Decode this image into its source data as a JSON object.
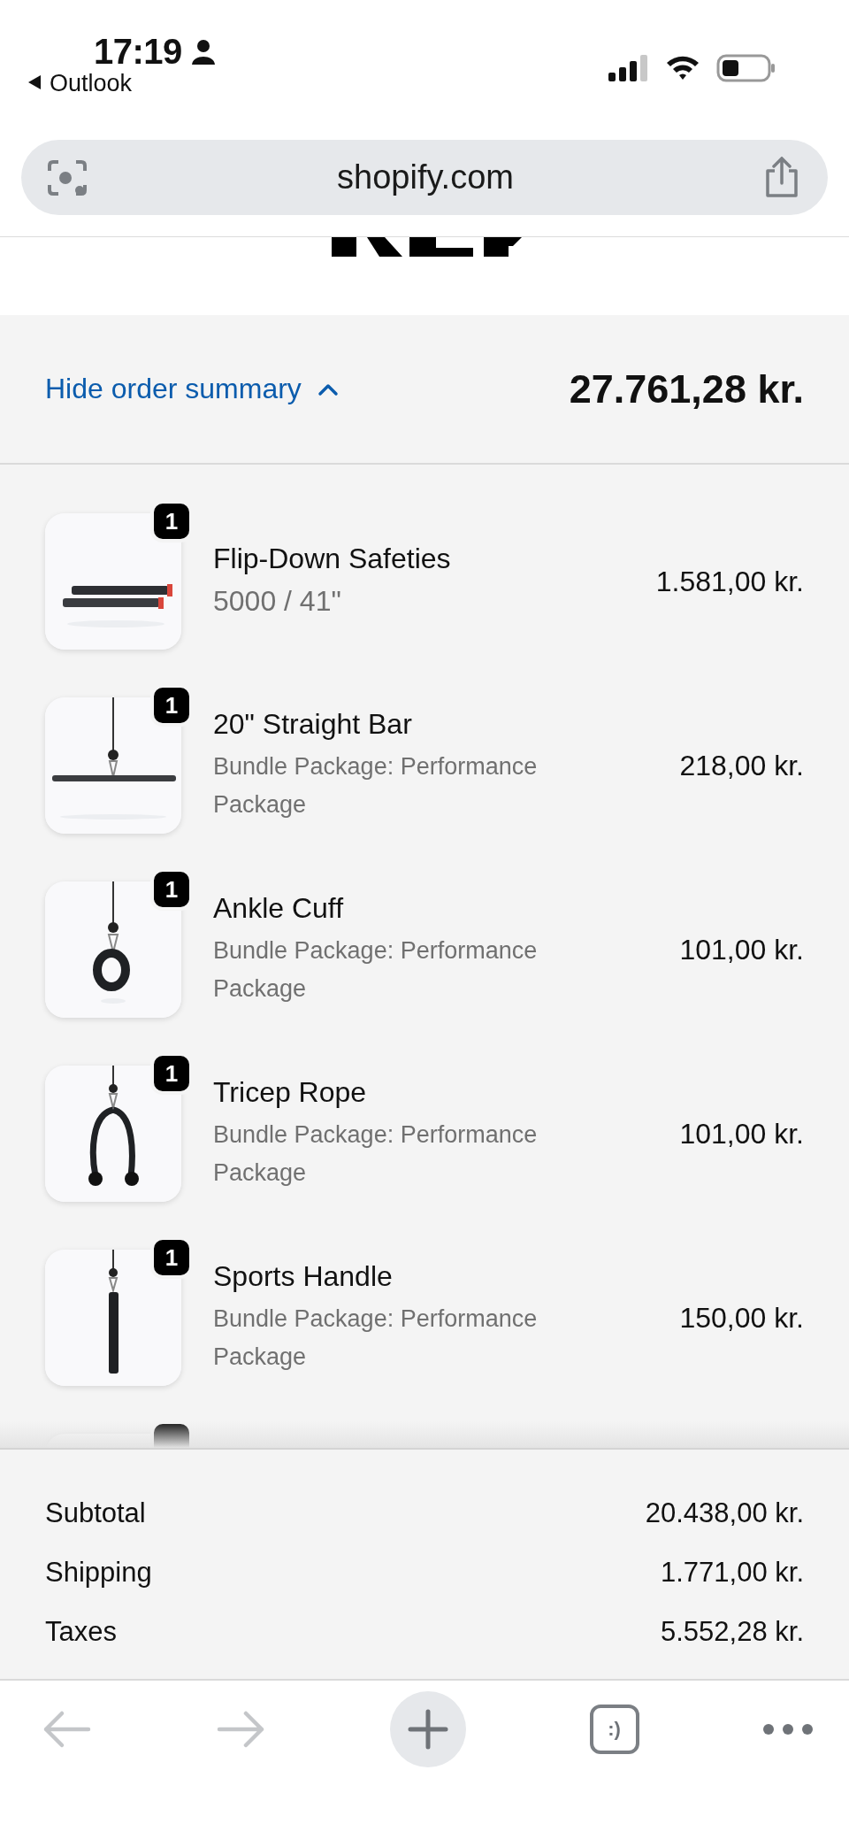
{
  "status_bar": {
    "time": "17:19",
    "back_app": "Outlook"
  },
  "address_bar": {
    "url": "shopify.com"
  },
  "order_summary": {
    "toggle_label": "Hide order summary",
    "expanded": true,
    "total": "27.761,28 kr."
  },
  "line_items": [
    {
      "name": "Flip-Down Safeties",
      "variant": "5000 / 41\"",
      "price": "1.581,00 kr.",
      "quantity": "1",
      "kind": "primary"
    },
    {
      "name": "20\" Straight Bar",
      "variant": "Bundle Package: Performance Package",
      "price": "218,00 kr.",
      "quantity": "1",
      "kind": "bundle"
    },
    {
      "name": "Ankle Cuff",
      "variant": "Bundle Package: Performance Package",
      "price": "101,00 kr.",
      "quantity": "1",
      "kind": "bundle"
    },
    {
      "name": "Tricep Rope",
      "variant": "Bundle Package: Performance Package",
      "price": "101,00 kr.",
      "quantity": "1",
      "kind": "bundle"
    },
    {
      "name": "Sports Handle",
      "variant": "Bundle Package: Performance Package",
      "price": "150,00 kr.",
      "quantity": "1",
      "kind": "bundle"
    }
  ],
  "totals": [
    {
      "label": "Subtotal",
      "value": "20.438,00 kr."
    },
    {
      "label": "Shipping",
      "value": "1.771,00 kr."
    },
    {
      "label": "Taxes",
      "value": "5.552,28 kr."
    }
  ],
  "toolbar": {
    "back_disabled": true,
    "forward_disabled": true,
    "tabs_label": ":)"
  }
}
